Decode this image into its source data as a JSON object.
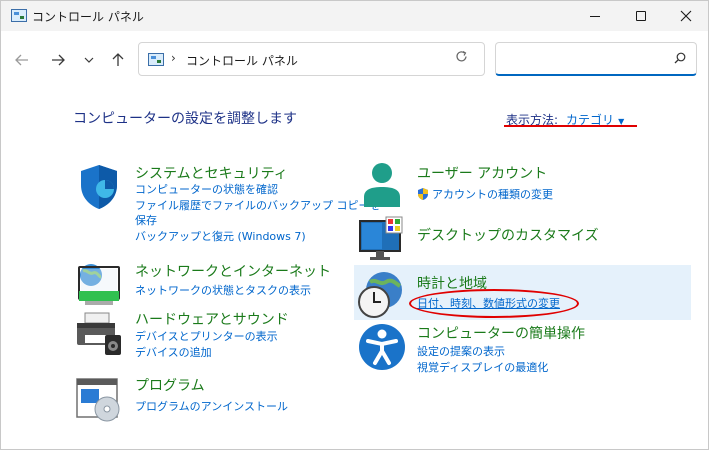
{
  "window": {
    "title": "コントロール パネル"
  },
  "address": {
    "separator": "›",
    "path": "コントロール パネル",
    "search_placeholder": ""
  },
  "main": {
    "heading": "コンピューターの設定を調整します",
    "view_by_label": "表示方法:",
    "view_by_value": "カテゴリ"
  },
  "categories": [
    {
      "title": "システムとセキュリティ",
      "links": [
        "コンピューターの状態を確認",
        "ファイル履歴でファイルのバックアップ コピーを",
        "保存",
        "バックアップと復元 (Windows 7)"
      ]
    },
    {
      "title": "ネットワークとインターネット",
      "links": [
        "ネットワークの状態とタスクの表示"
      ]
    },
    {
      "title": "ハードウェアとサウンド",
      "links": [
        "デバイスとプリンターの表示",
        "デバイスの追加"
      ]
    },
    {
      "title": "プログラム",
      "links": [
        "プログラムのアンインストール"
      ]
    },
    {
      "title": "ユーザー アカウント",
      "links": [
        "アカウントの種類の変更"
      ]
    },
    {
      "title": "デスクトップのカスタマイズ",
      "links": []
    },
    {
      "title": "時計と地域",
      "links": [
        "日付、時刻、数値形式の変更"
      ]
    },
    {
      "title": "コンピューターの簡単操作",
      "links": [
        "設定の提案の表示",
        "視覚ディスプレイの最適化"
      ]
    }
  ],
  "colors": {
    "category_title": "#1a7a1a",
    "link": "#0066cc",
    "heading": "#1e3287",
    "annotation": "#e00000",
    "highlight": "#e5f1fb"
  },
  "icons": {
    "app": "control-panel-icon",
    "back": "arrow-left-icon",
    "forward": "arrow-right-icon",
    "recent": "chevron-down-icon",
    "up": "arrow-up-icon",
    "refresh": "refresh-icon",
    "search": "search-icon"
  }
}
